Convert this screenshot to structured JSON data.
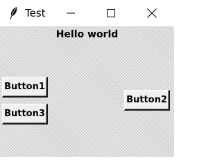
{
  "window": {
    "title": "Test",
    "icon": "feather-icon",
    "controls": [
      "minimize-icon",
      "maximize-icon",
      "close-icon"
    ]
  },
  "content": {
    "label": "Hello world"
  },
  "buttons": {
    "button1": "Button1",
    "button2": "Button2",
    "button3": "Button3"
  },
  "colors": {
    "titlebar_bg": "#ffffff",
    "client_bg": "#dedede",
    "button_bg": "#f0f0f0",
    "text": "#000000"
  }
}
